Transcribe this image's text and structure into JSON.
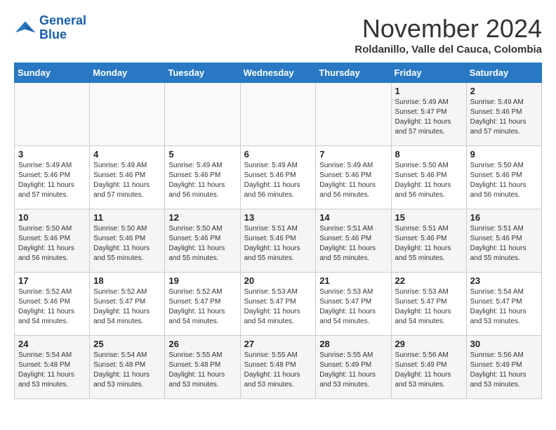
{
  "header": {
    "logo_line1": "General",
    "logo_line2": "Blue",
    "month_title": "November 2024",
    "location": "Roldanillo, Valle del Cauca, Colombia"
  },
  "columns": [
    "Sunday",
    "Monday",
    "Tuesday",
    "Wednesday",
    "Thursday",
    "Friday",
    "Saturday"
  ],
  "weeks": [
    [
      {
        "day": "",
        "sunrise": "",
        "sunset": "",
        "daylight": ""
      },
      {
        "day": "",
        "sunrise": "",
        "sunset": "",
        "daylight": ""
      },
      {
        "day": "",
        "sunrise": "",
        "sunset": "",
        "daylight": ""
      },
      {
        "day": "",
        "sunrise": "",
        "sunset": "",
        "daylight": ""
      },
      {
        "day": "",
        "sunrise": "",
        "sunset": "",
        "daylight": ""
      },
      {
        "day": "1",
        "sunrise": "Sunrise: 5:49 AM",
        "sunset": "Sunset: 5:47 PM",
        "daylight": "Daylight: 11 hours and 57 minutes."
      },
      {
        "day": "2",
        "sunrise": "Sunrise: 5:49 AM",
        "sunset": "Sunset: 5:46 PM",
        "daylight": "Daylight: 11 hours and 57 minutes."
      }
    ],
    [
      {
        "day": "3",
        "sunrise": "Sunrise: 5:49 AM",
        "sunset": "Sunset: 5:46 PM",
        "daylight": "Daylight: 11 hours and 57 minutes."
      },
      {
        "day": "4",
        "sunrise": "Sunrise: 5:49 AM",
        "sunset": "Sunset: 5:46 PM",
        "daylight": "Daylight: 11 hours and 57 minutes."
      },
      {
        "day": "5",
        "sunrise": "Sunrise: 5:49 AM",
        "sunset": "Sunset: 5:46 PM",
        "daylight": "Daylight: 11 hours and 56 minutes."
      },
      {
        "day": "6",
        "sunrise": "Sunrise: 5:49 AM",
        "sunset": "Sunset: 5:46 PM",
        "daylight": "Daylight: 11 hours and 56 minutes."
      },
      {
        "day": "7",
        "sunrise": "Sunrise: 5:49 AM",
        "sunset": "Sunset: 5:46 PM",
        "daylight": "Daylight: 11 hours and 56 minutes."
      },
      {
        "day": "8",
        "sunrise": "Sunrise: 5:50 AM",
        "sunset": "Sunset: 5:46 PM",
        "daylight": "Daylight: 11 hours and 56 minutes."
      },
      {
        "day": "9",
        "sunrise": "Sunrise: 5:50 AM",
        "sunset": "Sunset: 5:46 PM",
        "daylight": "Daylight: 11 hours and 56 minutes."
      }
    ],
    [
      {
        "day": "10",
        "sunrise": "Sunrise: 5:50 AM",
        "sunset": "Sunset: 5:46 PM",
        "daylight": "Daylight: 11 hours and 56 minutes."
      },
      {
        "day": "11",
        "sunrise": "Sunrise: 5:50 AM",
        "sunset": "Sunset: 5:46 PM",
        "daylight": "Daylight: 11 hours and 55 minutes."
      },
      {
        "day": "12",
        "sunrise": "Sunrise: 5:50 AM",
        "sunset": "Sunset: 5:46 PM",
        "daylight": "Daylight: 11 hours and 55 minutes."
      },
      {
        "day": "13",
        "sunrise": "Sunrise: 5:51 AM",
        "sunset": "Sunset: 5:46 PM",
        "daylight": "Daylight: 11 hours and 55 minutes."
      },
      {
        "day": "14",
        "sunrise": "Sunrise: 5:51 AM",
        "sunset": "Sunset: 5:46 PM",
        "daylight": "Daylight: 11 hours and 55 minutes."
      },
      {
        "day": "15",
        "sunrise": "Sunrise: 5:51 AM",
        "sunset": "Sunset: 5:46 PM",
        "daylight": "Daylight: 11 hours and 55 minutes."
      },
      {
        "day": "16",
        "sunrise": "Sunrise: 5:51 AM",
        "sunset": "Sunset: 5:46 PM",
        "daylight": "Daylight: 11 hours and 55 minutes."
      }
    ],
    [
      {
        "day": "17",
        "sunrise": "Sunrise: 5:52 AM",
        "sunset": "Sunset: 5:46 PM",
        "daylight": "Daylight: 11 hours and 54 minutes."
      },
      {
        "day": "18",
        "sunrise": "Sunrise: 5:52 AM",
        "sunset": "Sunset: 5:47 PM",
        "daylight": "Daylight: 11 hours and 54 minutes."
      },
      {
        "day": "19",
        "sunrise": "Sunrise: 5:52 AM",
        "sunset": "Sunset: 5:47 PM",
        "daylight": "Daylight: 11 hours and 54 minutes."
      },
      {
        "day": "20",
        "sunrise": "Sunrise: 5:53 AM",
        "sunset": "Sunset: 5:47 PM",
        "daylight": "Daylight: 11 hours and 54 minutes."
      },
      {
        "day": "21",
        "sunrise": "Sunrise: 5:53 AM",
        "sunset": "Sunset: 5:47 PM",
        "daylight": "Daylight: 11 hours and 54 minutes."
      },
      {
        "day": "22",
        "sunrise": "Sunrise: 5:53 AM",
        "sunset": "Sunset: 5:47 PM",
        "daylight": "Daylight: 11 hours and 54 minutes."
      },
      {
        "day": "23",
        "sunrise": "Sunrise: 5:54 AM",
        "sunset": "Sunset: 5:47 PM",
        "daylight": "Daylight: 11 hours and 53 minutes."
      }
    ],
    [
      {
        "day": "24",
        "sunrise": "Sunrise: 5:54 AM",
        "sunset": "Sunset: 5:48 PM",
        "daylight": "Daylight: 11 hours and 53 minutes."
      },
      {
        "day": "25",
        "sunrise": "Sunrise: 5:54 AM",
        "sunset": "Sunset: 5:48 PM",
        "daylight": "Daylight: 11 hours and 53 minutes."
      },
      {
        "day": "26",
        "sunrise": "Sunrise: 5:55 AM",
        "sunset": "Sunset: 5:48 PM",
        "daylight": "Daylight: 11 hours and 53 minutes."
      },
      {
        "day": "27",
        "sunrise": "Sunrise: 5:55 AM",
        "sunset": "Sunset: 5:48 PM",
        "daylight": "Daylight: 11 hours and 53 minutes."
      },
      {
        "day": "28",
        "sunrise": "Sunrise: 5:55 AM",
        "sunset": "Sunset: 5:49 PM",
        "daylight": "Daylight: 11 hours and 53 minutes."
      },
      {
        "day": "29",
        "sunrise": "Sunrise: 5:56 AM",
        "sunset": "Sunset: 5:49 PM",
        "daylight": "Daylight: 11 hours and 53 minutes."
      },
      {
        "day": "30",
        "sunrise": "Sunrise: 5:56 AM",
        "sunset": "Sunset: 5:49 PM",
        "daylight": "Daylight: 11 hours and 53 minutes."
      }
    ]
  ]
}
